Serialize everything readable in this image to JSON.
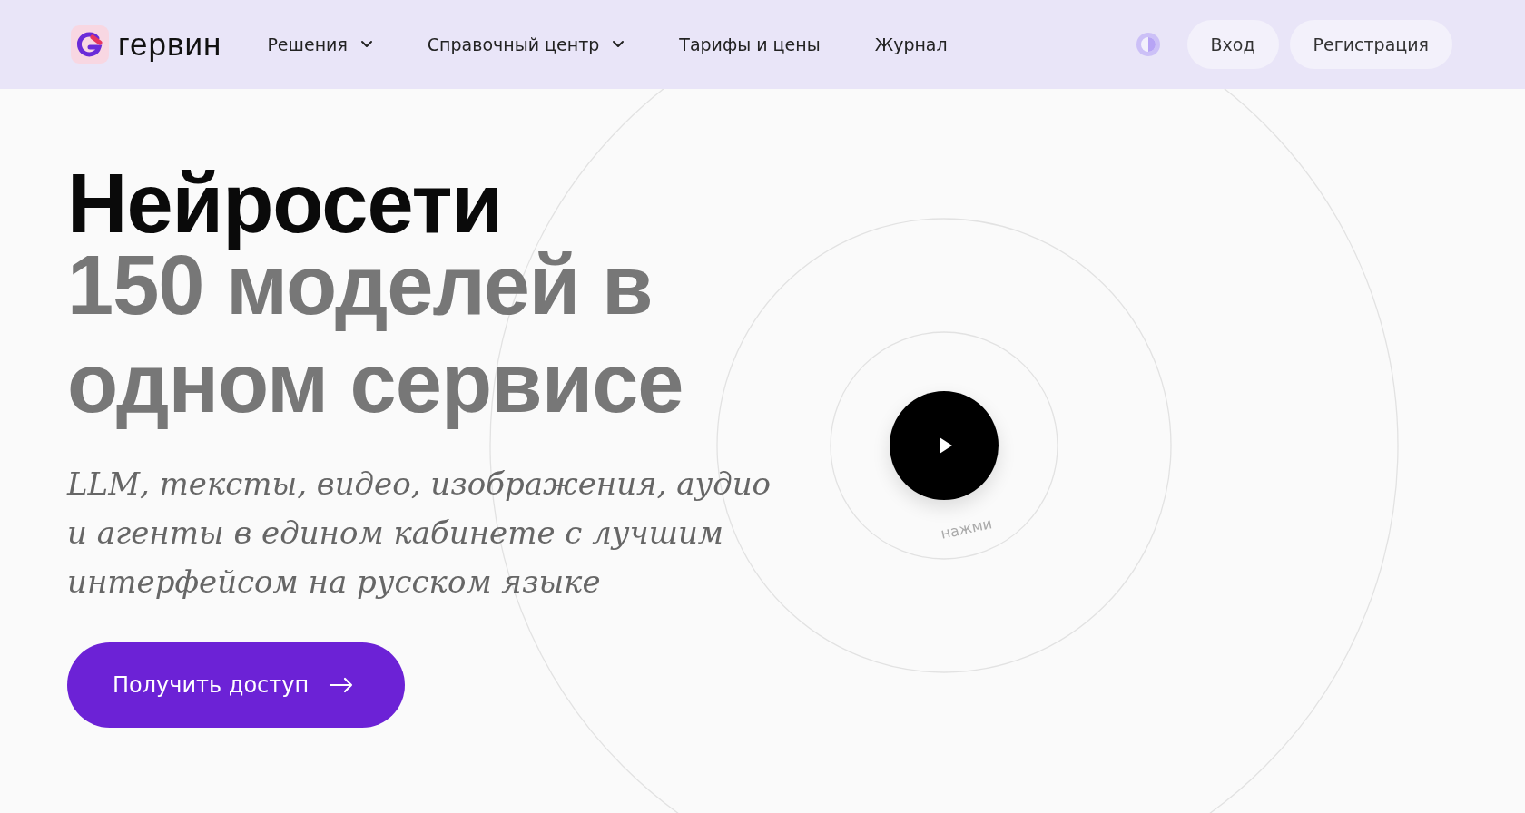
{
  "header": {
    "logo": "гервин",
    "nav": [
      {
        "label": "Решения",
        "has_dropdown": true
      },
      {
        "label": "Справочный центр",
        "has_dropdown": true
      },
      {
        "label": "Тарифы и цены",
        "has_dropdown": false
      },
      {
        "label": "Журнал",
        "has_dropdown": false
      }
    ],
    "buttons": [
      "Вход",
      "Регистрация"
    ]
  },
  "hero": {
    "title": "Нейросети",
    "title_accent": "150 моделей в одном сервисе",
    "subtitle": "LLM, тексты, видео, изображения, аудио и агенты в едином кабинете с лучшим интерфейсом на русском языке",
    "cta": "Получить доступ",
    "play_caption": "нажми"
  }
}
